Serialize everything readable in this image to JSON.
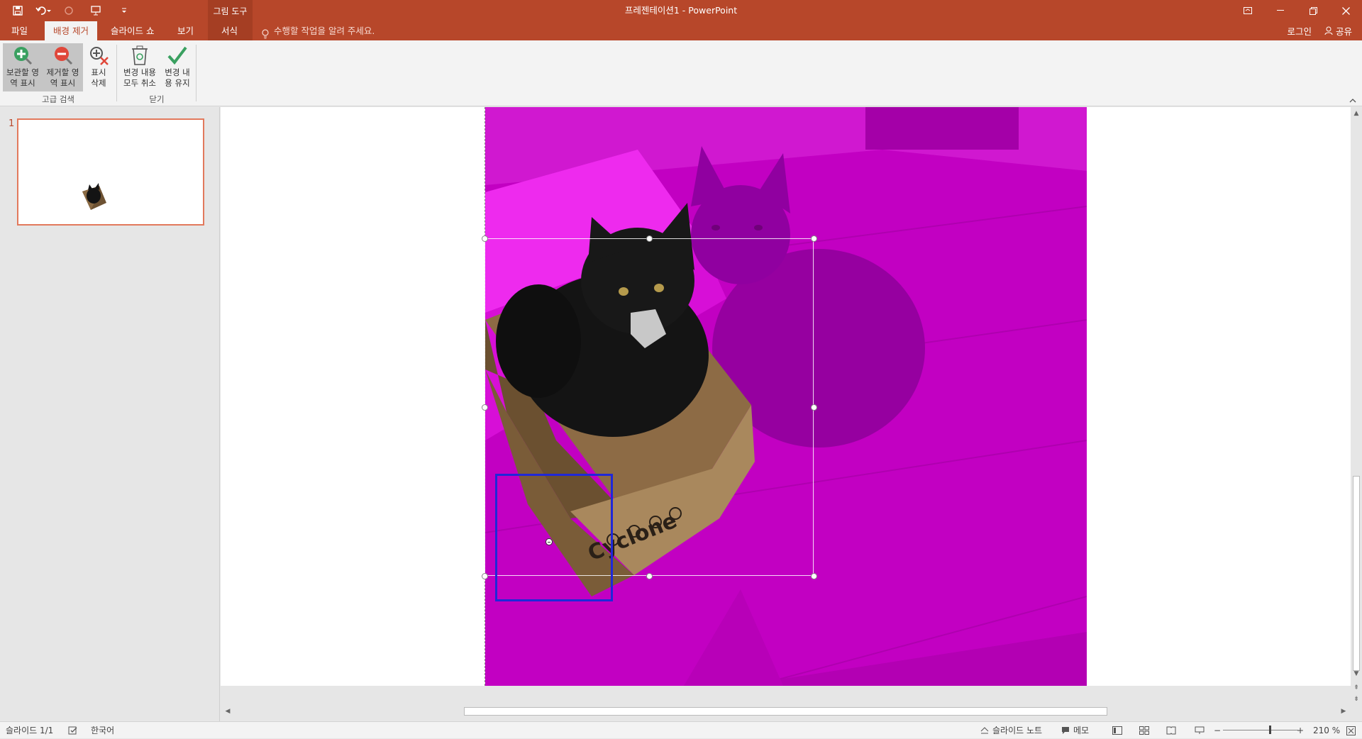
{
  "titlebar": {
    "document_title": "프레젠테이션1 - PowerPoint",
    "contextual_group": "그림 도구"
  },
  "tabs": [
    {
      "label": "파일",
      "active": false
    },
    {
      "label": "배경 제거",
      "active": true
    },
    {
      "label": "슬라이드 쇼",
      "active": false
    },
    {
      "label": "보기",
      "active": false
    },
    {
      "label": "서식",
      "active": false
    }
  ],
  "tell_me": "수행할 작업을 알려 주세요.",
  "account": {
    "login": "로그인",
    "share": "공유"
  },
  "ribbon": {
    "buttons": [
      {
        "label": "보관할 영\n역 표시",
        "icon": "plus-circle-pencil-icon",
        "pressed": true
      },
      {
        "label": "제거할 영\n역 표시",
        "icon": "minus-circle-pencil-icon",
        "pressed": true
      },
      {
        "label": "표시\n삭제",
        "icon": "delete-mark-icon",
        "pressed": false
      },
      {
        "label": "변경 내용\n모두 취소",
        "icon": "discard-changes-icon",
        "pressed": false
      },
      {
        "label": "변경 내\n용 유지",
        "icon": "keep-changes-check-icon",
        "pressed": false
      }
    ],
    "groups": [
      {
        "label": "고급 검색"
      },
      {
        "label": "닫기"
      }
    ]
  },
  "slides_pane": {
    "slide_number": "1"
  },
  "statusbar": {
    "slide_info": "슬라이드 1/1",
    "language": "한국어",
    "notes": "슬라이드 노트",
    "comments": "메모",
    "zoom": "210 %"
  },
  "colors": {
    "accent": "#b7472a",
    "removal_overlay": "#c800c8",
    "mark_box": "#1f28d8"
  }
}
